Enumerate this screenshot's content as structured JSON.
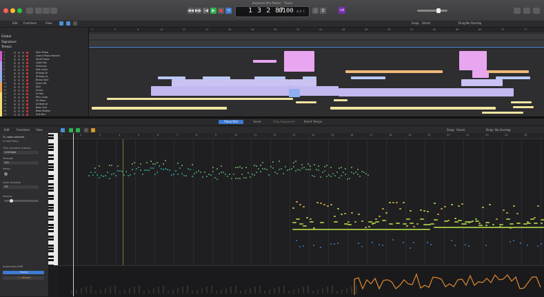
{
  "window": {
    "title": "Daybreak Mix Master - Tracks",
    "traffic_lights": {
      "close": "#ff5f57",
      "minimize": "#febc2e",
      "zoom": "#28c840"
    }
  },
  "transport": {
    "position": "1 3 2 87",
    "position_label": "1 3 2 87",
    "tempo": "0100",
    "signature": "4/4 C",
    "mode_badge": "cd",
    "accent": "#3d7ad1"
  },
  "arrange_toolbar": {
    "edit_label": "Edit",
    "functions_label": "Functions",
    "view_label": "View",
    "snap_label": "Snap:",
    "snap_value": "Smart",
    "drag_label": "Drag:",
    "drag_value": "No Overlap"
  },
  "tracklist": {
    "headers": [
      "Global",
      "Signature",
      "Tempo"
    ],
    "tracks": [
      {
        "name": "Solo Piano",
        "color": "#d05ad4"
      },
      {
        "name": "Grand Piano Reverb",
        "color": "#d05ad4"
      },
      {
        "name": "Synth Bass",
        "color": "#d05ad4"
      },
      {
        "name": "Lead Vox",
        "color": "#b0a0e8"
      },
      {
        "name": "Harmony",
        "color": "#b0a0e8"
      },
      {
        "name": "Pad Layer",
        "color": "#b0a0e8"
      },
      {
        "name": "Strings Hi",
        "color": "#8fb0f0"
      },
      {
        "name": "Strings Lo",
        "color": "#8fb0f0"
      },
      {
        "name": "Brass Sect",
        "color": "#8fb0f0"
      },
      {
        "name": "Drum Kit",
        "color": "#f0a050"
      },
      {
        "name": "Kick",
        "color": "#f0a050"
      },
      {
        "name": "Snare",
        "color": "#f0a050"
      },
      {
        "name": "Hi Hat",
        "color": "#f0e070"
      },
      {
        "name": "Perc Loop",
        "color": "#f0e070"
      },
      {
        "name": "FX Riser",
        "color": "#f0e070"
      },
      {
        "name": "Ambience",
        "color": "#f0e070"
      },
      {
        "name": "Bass Sub",
        "color": "#f0e070"
      },
      {
        "name": "Bass Master",
        "color": "#f0e070"
      },
      {
        "name": "Sub Bus",
        "color": "#f0e070"
      }
    ]
  },
  "ruler_bars": [
    "1",
    "5",
    "9",
    "13",
    "17",
    "21",
    "25",
    "29",
    "33",
    "37",
    "41",
    "45",
    "49",
    "53",
    "57",
    "61",
    "65",
    "69",
    "73",
    "77"
  ],
  "editor_tabs": [
    "Piano Roll",
    "Score",
    "Step Sequencer",
    "Smart Tempo"
  ],
  "piano_toolbar": {
    "edit_label": "Edit",
    "functions_label": "Functions",
    "view_label": "View",
    "snap_label": "Snap:",
    "snap_value": "Smart",
    "drag_label": "Drag:",
    "drag_value": "No Overlap"
  },
  "inspector": {
    "selection": "32 notes selected",
    "selection_sub": "in Solo Piano",
    "time_quantize_label": "Time Quantize (classic)",
    "time_quantize_value": "1/16 Note",
    "strength_label": "Strength",
    "strength_value": "100",
    "swing_label": "Swing",
    "swing_value": "0",
    "scale_label": "Scale Quantize",
    "scale_value": "Off",
    "velocity_label": "Velocity",
    "automation_label": "Automation/MIDI",
    "automation_value": "Region",
    "automation_param": "7 - Volume"
  },
  "piano_ruler_bars": [
    "1",
    "2",
    "3",
    "4",
    "5",
    "6",
    "7",
    "8",
    "9",
    "10",
    "11",
    "12",
    "13",
    "14",
    "15",
    "16",
    "17",
    "18",
    "19",
    "20",
    "21",
    "22",
    "23",
    "24",
    "25"
  ]
}
